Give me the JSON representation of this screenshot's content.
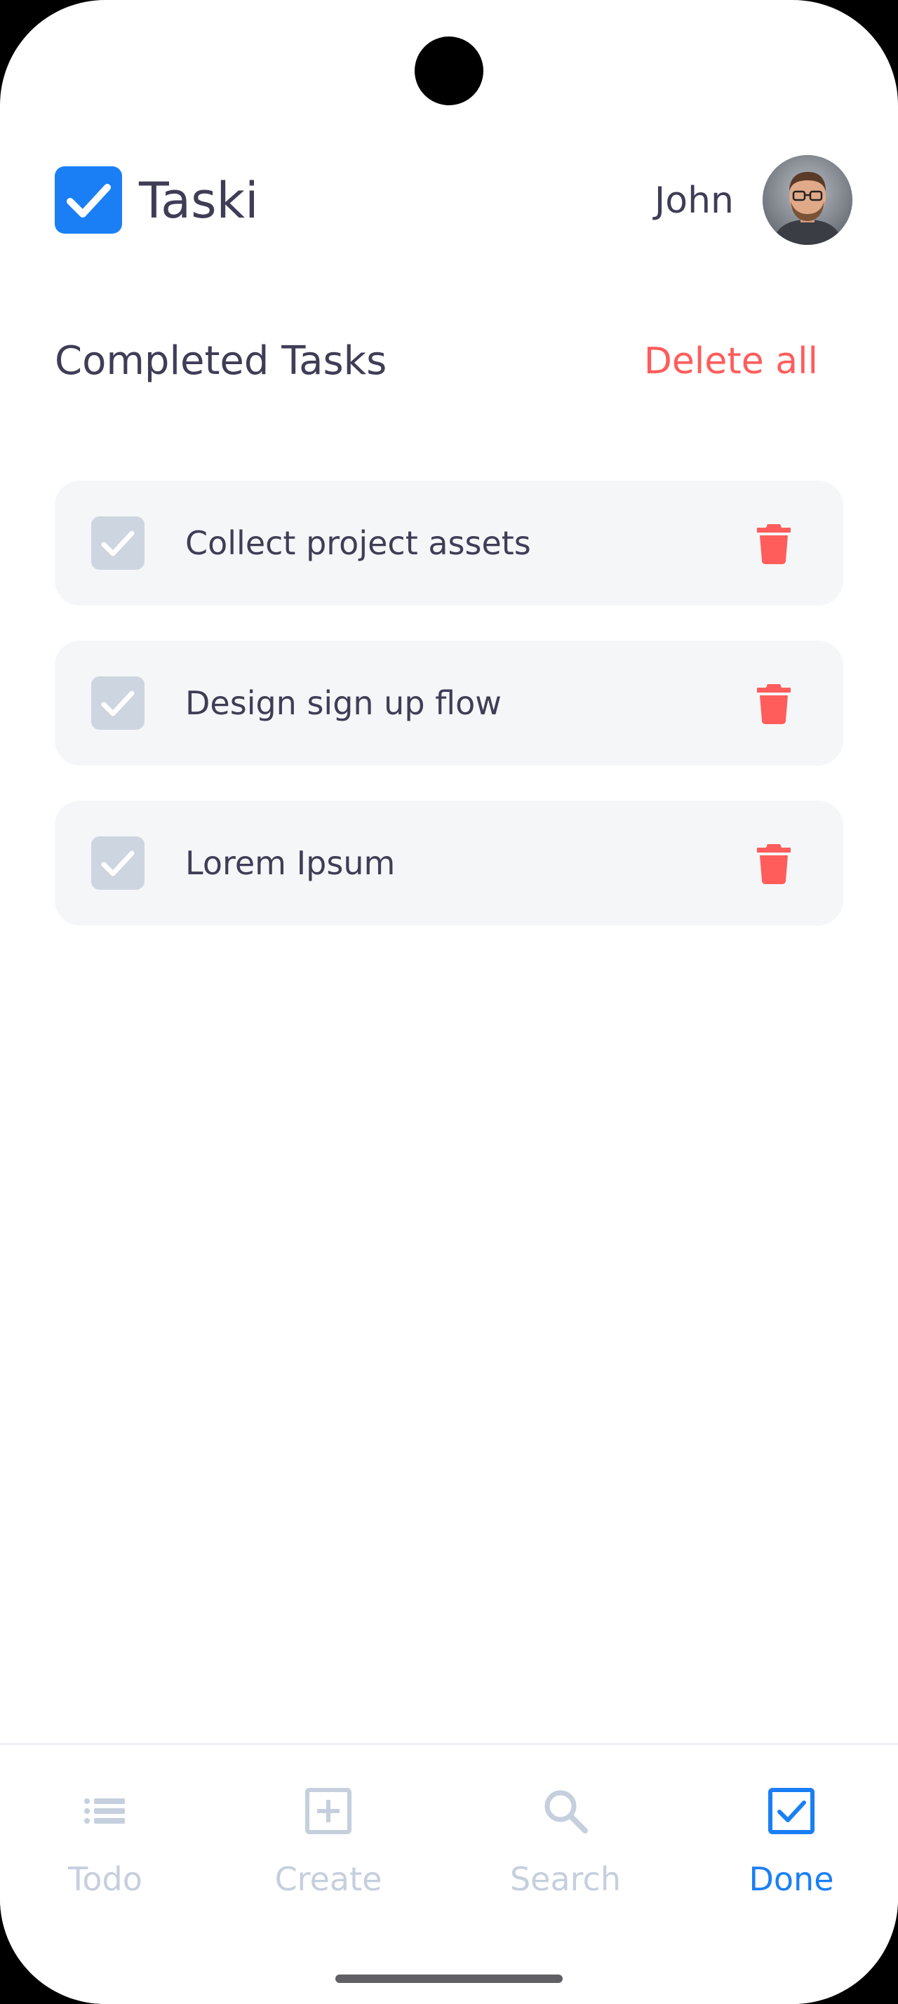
{
  "app": {
    "title": "Taski",
    "user_name": "John",
    "accent_color": "#1a7ff5",
    "danger_color": "#ff5c5c"
  },
  "section": {
    "title": "Completed Tasks",
    "delete_all_label": "Delete all"
  },
  "tasks": [
    {
      "label": "Collect project assets",
      "checked": true
    },
    {
      "label": "Design sign up flow",
      "checked": true
    },
    {
      "label": "Lorem Ipsum",
      "checked": true
    }
  ],
  "nav": {
    "items": [
      {
        "label": "Todo",
        "icon": "list-icon",
        "active": false
      },
      {
        "label": "Create",
        "icon": "plus-square-icon",
        "active": false
      },
      {
        "label": "Search",
        "icon": "search-icon",
        "active": false
      },
      {
        "label": "Done",
        "icon": "check-square-icon",
        "active": true
      }
    ]
  }
}
